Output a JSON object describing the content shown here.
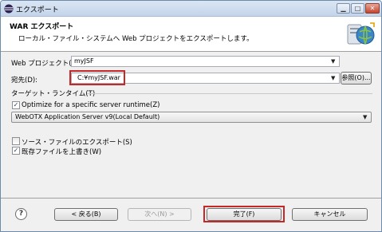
{
  "window": {
    "title": "エクスポート",
    "controls": {
      "minimize": "▁",
      "maximize": "□",
      "close": "✕"
    }
  },
  "banner": {
    "title": "WAR エクスポート",
    "description": "ローカル・ファイル・システムへ Web プロジェクトをエクスポートします。"
  },
  "form": {
    "project_label": "Web プロジェクト(P):",
    "project_value": "myJSF",
    "destination_label": "宛先(D):",
    "destination_value": "C:¥myJSF.war",
    "browse_label": "参照(O)..."
  },
  "runtime": {
    "group_label": "ターゲット・ランタイム(T)",
    "optimize_label": "Optimize for a specific server runtime(Z)",
    "optimize_checked": true,
    "server_value": "WebOTX Application Server v9(Local Default)"
  },
  "options": {
    "export_source_label": "ソース・ファイルのエクスポート(S)",
    "export_source_checked": false,
    "overwrite_label": "既存ファイルを上書き(W)",
    "overwrite_checked": true
  },
  "buttons": {
    "help": "?",
    "back": "< 戻る(B)",
    "next": "次へ(N) >",
    "finish": "完了(F)",
    "cancel": "キャンセル"
  },
  "icons": {
    "app": "eclipse-icon",
    "wizard": "war-export-wizard-icon",
    "dropdown": "▼",
    "check": "✓"
  },
  "colors": {
    "highlight": "#c62828",
    "titlebar": "#c3d4ea"
  }
}
